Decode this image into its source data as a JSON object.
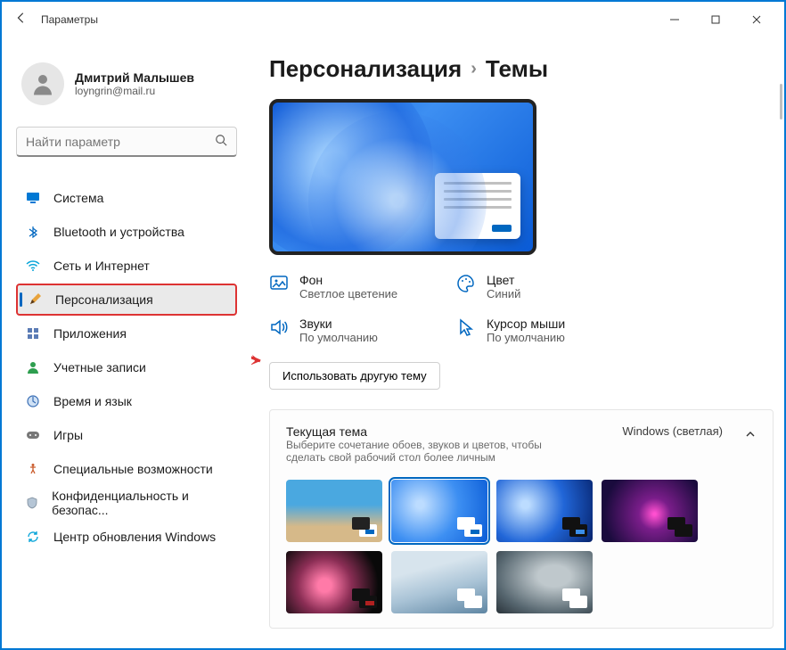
{
  "window": {
    "title": "Параметры"
  },
  "user": {
    "name": "Дмитрий Малышев",
    "email": "loyngrin@mail.ru"
  },
  "search": {
    "placeholder": "Найти параметр"
  },
  "nav": {
    "system": "Система",
    "bluetooth": "Bluetooth и устройства",
    "network": "Сеть и Интернет",
    "personalization": "Персонализация",
    "apps": "Приложения",
    "accounts": "Учетные записи",
    "timelang": "Время и язык",
    "gaming": "Игры",
    "accessibility": "Специальные возможности",
    "privacy": "Конфиденциальность и безопас...",
    "update": "Центр обновления Windows"
  },
  "breadcrumb": {
    "parent": "Персонализация",
    "current": "Темы"
  },
  "theme_props": {
    "background": {
      "label": "Фон",
      "value": "Светлое цветение"
    },
    "color": {
      "label": "Цвет",
      "value": "Синий"
    },
    "sounds": {
      "label": "Звуки",
      "value": "По умолчанию"
    },
    "cursor": {
      "label": "Курсор мыши",
      "value": "По умолчанию"
    }
  },
  "buttons": {
    "use_other_theme": "Использовать другую тему"
  },
  "current_theme_card": {
    "title": "Текущая тема",
    "subtitle": "Выберите сочетание обоев, звуков и цветов, чтобы сделать свой рабочий стол более личным",
    "value": "Windows (светлая)"
  }
}
